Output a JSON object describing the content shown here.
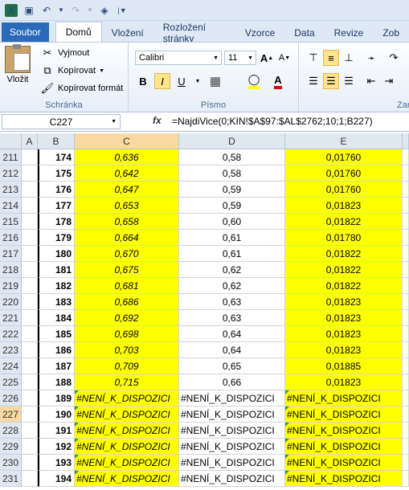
{
  "qat": {
    "icons": [
      "excel-logo-icon",
      "save-icon",
      "undo-icon",
      "undo-dropdown-icon",
      "redo-icon",
      "redo-dropdown-icon",
      "binoculars-icon",
      "customize-qat-icon"
    ]
  },
  "tabs": [
    "Soubor",
    "Domů",
    "Vložení",
    "Rozložení stránky",
    "Vzorce",
    "Data",
    "Revize",
    "Zob"
  ],
  "ribbon": {
    "clipboard": {
      "paste": "Vložit",
      "cut": "Vyjmout",
      "copy": "Kopírovat",
      "format_painter": "Kopírovat formát",
      "group": "Schránka"
    },
    "font": {
      "name": "Calibri",
      "size": "11",
      "group": "Písmo",
      "bold": "B",
      "italic": "I",
      "underline": "U",
      "grow": "A",
      "shrink": "A"
    },
    "alignment": {
      "group": "Zar"
    }
  },
  "formula_bar": {
    "name_box": "C227",
    "fx": "fx",
    "formula": "=NajdiVice(0;KIN!$A$97:$AL$2762;10;1;B227)"
  },
  "columns": [
    "A",
    "B",
    "C",
    "D",
    "E"
  ],
  "rows": [
    {
      "r": "211",
      "b": "174",
      "c": "0,636",
      "d": "0,58",
      "e": "0,01760"
    },
    {
      "r": "212",
      "b": "175",
      "c": "0,642",
      "d": "0,58",
      "e": "0,01760"
    },
    {
      "r": "213",
      "b": "176",
      "c": "0,647",
      "d": "0,59",
      "e": "0,01760"
    },
    {
      "r": "214",
      "b": "177",
      "c": "0,653",
      "d": "0,59",
      "e": "0,01823"
    },
    {
      "r": "215",
      "b": "178",
      "c": "0,658",
      "d": "0,60",
      "e": "0,01822"
    },
    {
      "r": "216",
      "b": "179",
      "c": "0,664",
      "d": "0,61",
      "e": "0,01780"
    },
    {
      "r": "217",
      "b": "180",
      "c": "0,670",
      "d": "0,61",
      "e": "0,01822"
    },
    {
      "r": "218",
      "b": "181",
      "c": "0,675",
      "d": "0,62",
      "e": "0,01822"
    },
    {
      "r": "219",
      "b": "182",
      "c": "0,681",
      "d": "0,62",
      "e": "0,01822"
    },
    {
      "r": "220",
      "b": "183",
      "c": "0,686",
      "d": "0,63",
      "e": "0,01823"
    },
    {
      "r": "221",
      "b": "184",
      "c": "0,692",
      "d": "0,63",
      "e": "0,01823"
    },
    {
      "r": "222",
      "b": "185",
      "c": "0,698",
      "d": "0,64",
      "e": "0,01823"
    },
    {
      "r": "223",
      "b": "186",
      "c": "0,703",
      "d": "0,64",
      "e": "0,01823"
    },
    {
      "r": "224",
      "b": "187",
      "c": "0,709",
      "d": "0,65",
      "e": "0,01885"
    },
    {
      "r": "225",
      "b": "188",
      "c": "0,715",
      "d": "0,66",
      "e": "0,01823"
    },
    {
      "r": "226",
      "b": "189",
      "c": "#NENÍ_K_DISPOZICI",
      "d": "#NENÍ_K_DISPOZICI",
      "e": "#NENÍ_K_DISPOZICI"
    },
    {
      "r": "227",
      "b": "190",
      "c": "#NENÍ_K_DISPOZICI",
      "d": "#NENÍ_K_DISPOZICI",
      "e": "#NENÍ_K_DISPOZICI"
    },
    {
      "r": "228",
      "b": "191",
      "c": "#NENÍ_K_DISPOZICI",
      "d": "#NENÍ_K_DISPOZICI",
      "e": "#NENÍ_K_DISPOZICI"
    },
    {
      "r": "229",
      "b": "192",
      "c": "#NENÍ_K_DISPOZICI",
      "d": "#NENÍ_K_DISPOZICI",
      "e": "#NENÍ_K_DISPOZICI"
    },
    {
      "r": "230",
      "b": "193",
      "c": "#NENÍ_K_DISPOZICI",
      "d": "#NENÍ_K_DISPOZICI",
      "e": "#NENÍ_K_DISPOZICI"
    },
    {
      "r": "231",
      "b": "194",
      "c": "#NENÍ_K_DISPOZICI",
      "d": "#NENÍ_K_DISPOZICI",
      "e": "#NENÍ_K_DISPOZICI"
    }
  ],
  "colors": {
    "highlight": "#ffff00",
    "error_indicator": "#2f9a3d",
    "file_tab": "#2a6ab9"
  }
}
